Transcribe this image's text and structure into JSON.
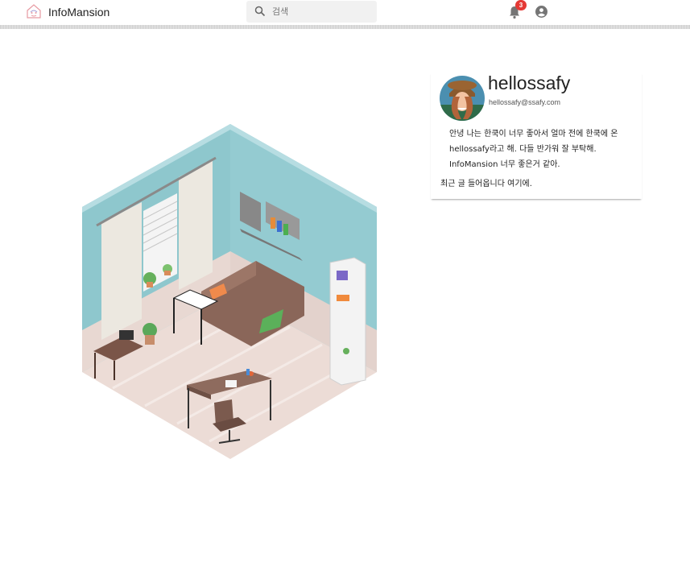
{
  "header": {
    "brand": "InfoMansion",
    "search": {
      "placeholder": "검색",
      "value": ""
    },
    "notifications": {
      "count": "3"
    }
  },
  "profile": {
    "username": "hellossafy",
    "email": "hellossafy@ssafy.com",
    "bio": "안녕 나는 한쿡이 너무 좋아서 얼마 전에 한쿡에 온 hellossafy라고 해. 다들 반가워 잘 부탁해. InfoMansion 너무 좋은거 같아.",
    "recent_posts": "최근 글 들어옵니다 여기에."
  },
  "colors": {
    "wall": "#8ec7cd",
    "floor": "#ecdcd6",
    "sofa": "#8a6659",
    "badge": "#e53935"
  },
  "icons": [
    "house-logo-icon",
    "search-icon",
    "bell-icon",
    "account-circle-icon"
  ]
}
